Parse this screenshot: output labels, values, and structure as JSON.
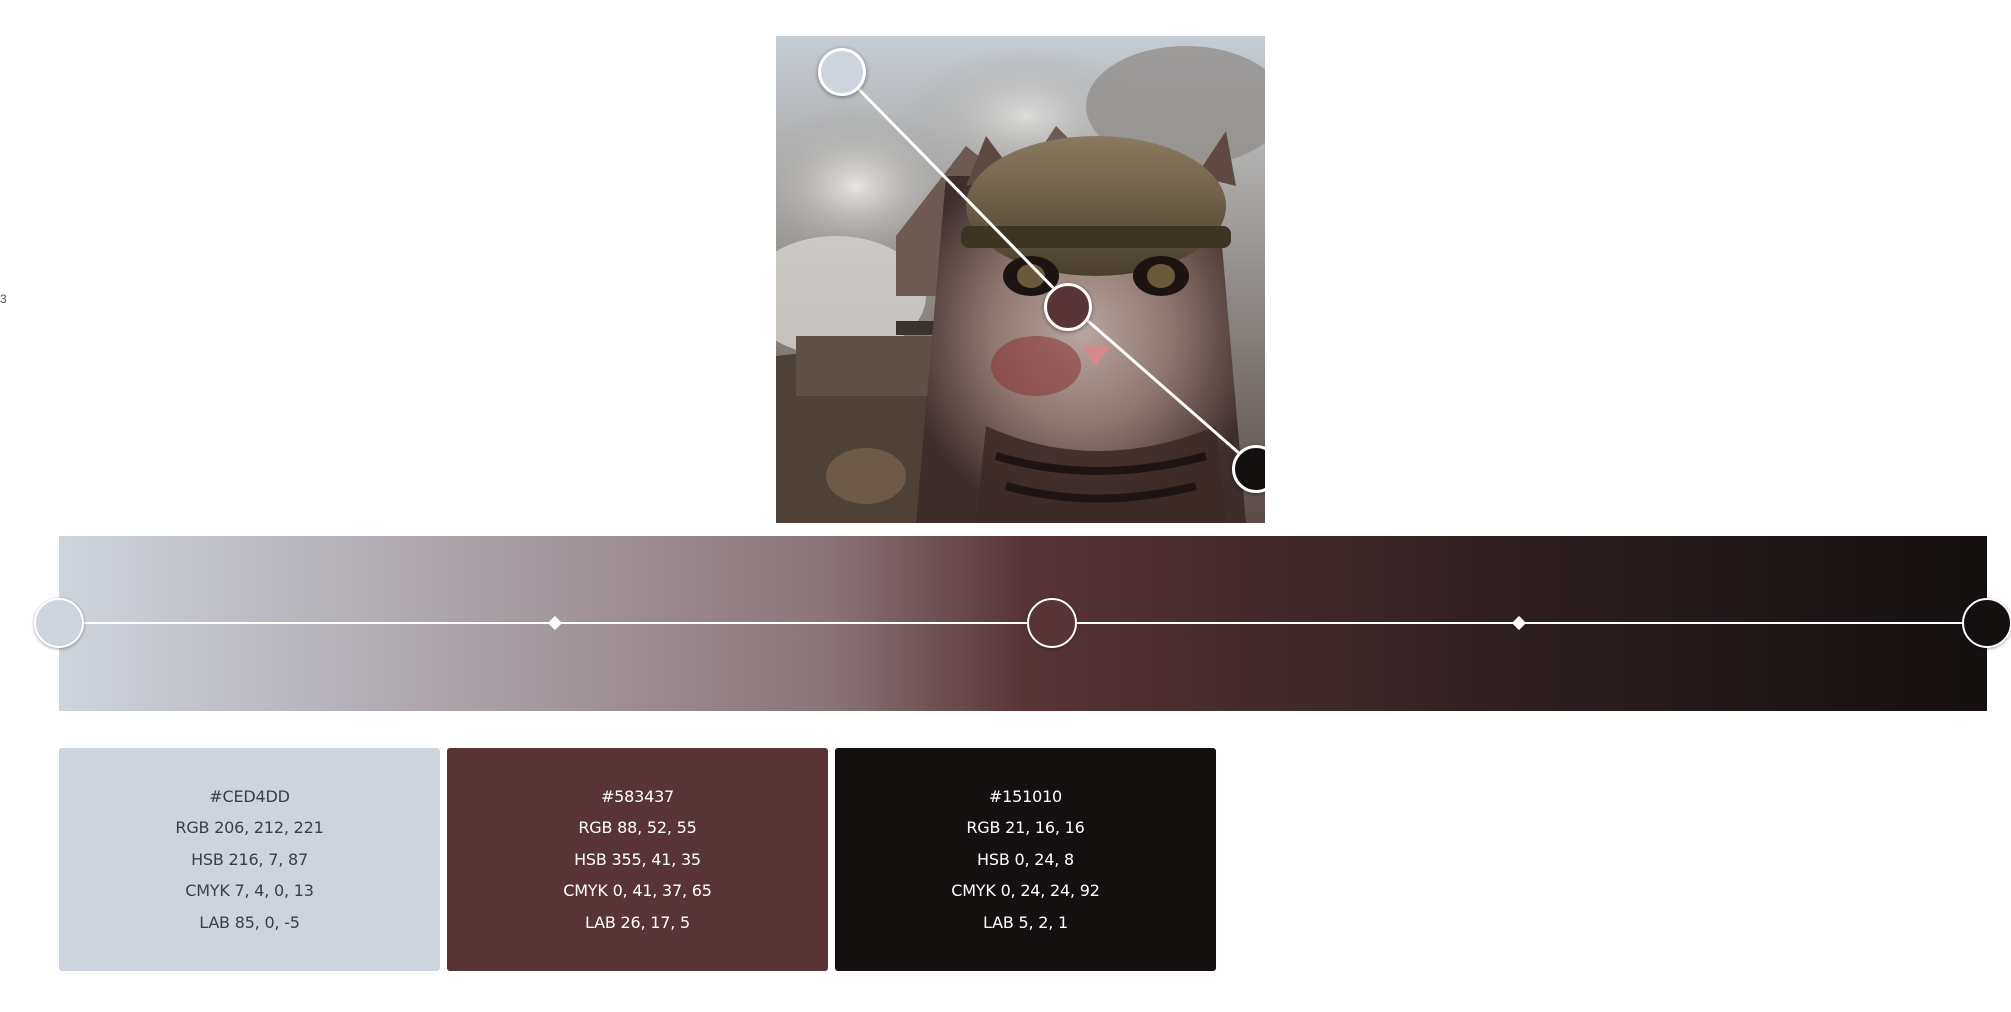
{
  "colors": {
    "stop1": "#CED4DD",
    "stop2": "#583437",
    "stop3": "#151010"
  },
  "swatches": [
    {
      "hex": "#CED4DD",
      "rgb": "RGB 206, 212, 221",
      "hsb": "HSB 216, 7, 87",
      "cmyk": "CMYK 7, 4, 0, 13",
      "lab": "LAB 85, 0, -5"
    },
    {
      "hex": "#583437",
      "rgb": "RGB 88, 52, 55",
      "hsb": "HSB 355, 41, 35",
      "cmyk": "CMYK 0, 41, 37, 65",
      "lab": "LAB 26, 17, 5"
    },
    {
      "hex": "#151010",
      "rgb": "RGB 21, 16, 16",
      "hsb": "HSB 0, 24, 8",
      "cmyk": "CMYK 0, 24, 24, 92",
      "lab": "LAB 5, 2, 1"
    }
  ]
}
